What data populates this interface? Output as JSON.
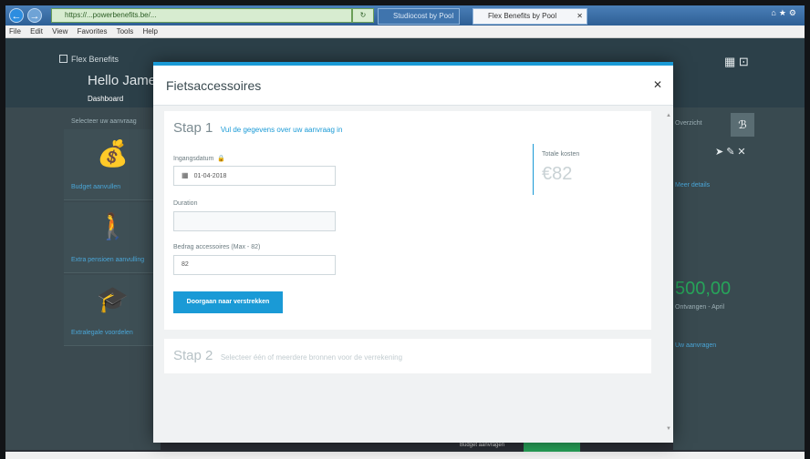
{
  "browser": {
    "address": "https://...powerbenefits.be/...",
    "tabs": [
      {
        "label": "Studiocost by Pool"
      },
      {
        "label": "Flex Benefits by Pool"
      }
    ],
    "menu": [
      "File",
      "Edit",
      "View",
      "Favorites",
      "Tools",
      "Help"
    ]
  },
  "app": {
    "brand": "Flex Benefits",
    "greeting": "Hello James",
    "tab_dashboard": "Dashboard",
    "left_panel_title": "Selecteer uw aanvraag",
    "left_cards": [
      {
        "icon": "money-bag-icon",
        "label": "Budget aanvullen"
      },
      {
        "icon": "walker-icon",
        "label": "Extra pensioen aanvulling"
      },
      {
        "icon": "graduation-cap-icon",
        "label": "Extralegale voordelen"
      }
    ],
    "right_panel": {
      "title": "Overzicht",
      "link": "Meer details",
      "amount": "500,00",
      "note": "Ontvangen - April",
      "bottom_link": "Uw aanvragen"
    },
    "bottom_label": "Budget aanvragen"
  },
  "modal": {
    "title": "Fietsaccessoires",
    "step1": {
      "num": "Stap 1",
      "desc": "Vul de gegevens over uw aanvraag in",
      "fields": [
        {
          "label": "Ingangsdatum",
          "value": "01-04-2018"
        },
        {
          "label": "Duration",
          "value": ""
        },
        {
          "label": "Bedrag accessoires (Max - 82)",
          "value": "82"
        }
      ],
      "button": "Doorgaan naar verstrekken",
      "total_label": "Totale kosten",
      "total_value": "€82"
    },
    "step2": {
      "num": "Stap 2",
      "desc": "Selecteer één of meerdere bronnen voor de verrekening"
    }
  },
  "colors": {
    "accent": "#1a9ad6",
    "success": "#27a45a",
    "header": "#2c4049"
  }
}
